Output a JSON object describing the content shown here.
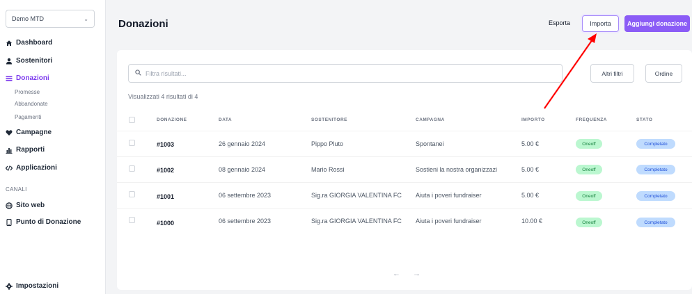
{
  "sidebar": {
    "org_select": "Demo MTD",
    "nav": {
      "dashboard": "Dashboard",
      "sostenitori": "Sostenitori",
      "donazioni": "Donazioni",
      "sub": [
        "Promesse",
        "Abbandonate",
        "Pagamenti"
      ],
      "campagne": "Campagne",
      "rapporti": "Rapporti",
      "applicazioni": "Applicazioni",
      "canali_label": "CANALI",
      "sito_web": "Sito web",
      "punto_donazione": "Punto di Donazione",
      "impostazioni": "Impostazioni"
    }
  },
  "header": {
    "title": "Donazioni",
    "export_label": "Esporta",
    "import_label": "Importa",
    "add_label": "Aggiungi donazione"
  },
  "filters": {
    "search_placeholder": "Filtra risultati...",
    "more_filters_label": "Altri filtri",
    "order_label": "Ordine",
    "results_text": "Visualizzati 4 risultati di 4"
  },
  "table": {
    "headers": [
      "DONAZIONE",
      "DATA",
      "SOSTENITORE",
      "CAMPAGNA",
      "IMPORTO",
      "FREQUENZA",
      "STATO"
    ],
    "rows": [
      {
        "id": "#1003",
        "date": "26 gennaio 2024",
        "supporter": "Pippo Pluto",
        "campaign": "Spontanei",
        "amount": "5.00 €",
        "frequency": "Oneoff",
        "status": "Completato"
      },
      {
        "id": "#1002",
        "date": "08 gennaio 2024",
        "supporter": "Mario Rossi",
        "campaign": "Sostieni la nostra organizzazi",
        "amount": "5.00 €",
        "frequency": "Oneoff",
        "status": "Completato"
      },
      {
        "id": "#1001",
        "date": "06 settembre 2023",
        "supporter": "Sig.ra GIORGIA VALENTINA FC",
        "campaign": "Aiuta i poveri fundraiser",
        "amount": "5.00 €",
        "frequency": "Oneoff",
        "status": "Completato"
      },
      {
        "id": "#1000",
        "date": "06 settembre 2023",
        "supporter": "Sig.ra GIORGIA VALENTINA FC",
        "campaign": "Aiuta i poveri fundraiser",
        "amount": "10.00 €",
        "frequency": "Oneoff",
        "status": "Completato"
      }
    ]
  },
  "pagination": {
    "prev": "←",
    "next": "→"
  },
  "colors": {
    "accent": "#8b5cf6",
    "annotation_arrow": "#ff0000"
  }
}
